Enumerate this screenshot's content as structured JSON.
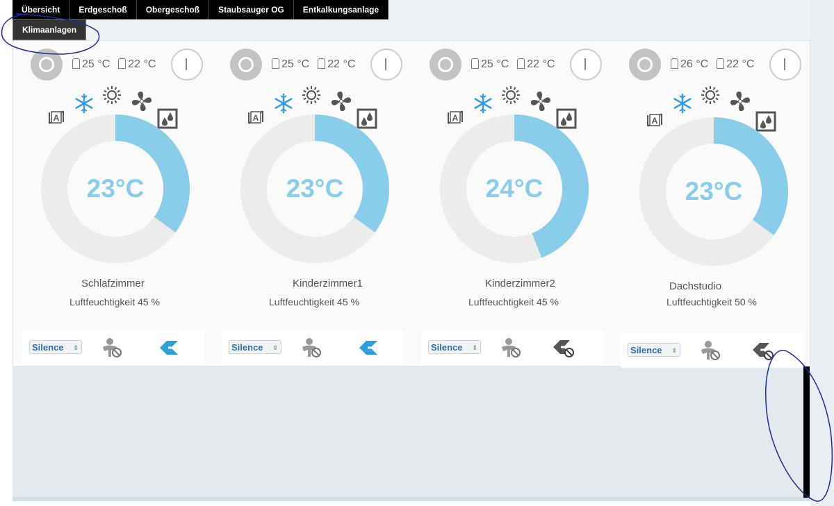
{
  "nav": {
    "tabs": [
      "Übersicht",
      "Erdgeschoß",
      "Obergeschoß",
      "Staubsauger OG",
      "Entkalkungsanlage"
    ],
    "active_tab": "Klimaanlagen"
  },
  "colors": {
    "accent": "#89cdeb",
    "track": "#ececec",
    "icon": "#555555",
    "select_text": "#2d6eab",
    "annotation": "#1c2aa0"
  },
  "units": [
    {
      "room": "Schlafzimmer",
      "setpoint": "23°C",
      "indoor_temp": "25 °C",
      "outdoor_temp": "22 °C",
      "humidity": "Luftfeuchtigkeit 45 %",
      "gauge_fraction": 0.35,
      "fan_mode": "Silence",
      "swing_active": true
    },
    {
      "room": "Kinderzimmer1",
      "setpoint": "23°C",
      "indoor_temp": "25 °C",
      "outdoor_temp": "22 °C",
      "humidity": "Luftfeuchtigkeit 45 %",
      "gauge_fraction": 0.35,
      "fan_mode": "Silence",
      "swing_active": true
    },
    {
      "room": "Kinderzimmer2",
      "setpoint": "24°C",
      "indoor_temp": "25 °C",
      "outdoor_temp": "22 °C",
      "humidity": "Luftfeuchtigkeit 45 %",
      "gauge_fraction": 0.44,
      "fan_mode": "Silence",
      "swing_active": false
    },
    {
      "room": "Dachstudio",
      "setpoint": "23°C",
      "indoor_temp": "26 °C",
      "outdoor_temp": "22 °C",
      "humidity": "Luftfeuchtigkeit 50 %",
      "gauge_fraction": 0.35,
      "fan_mode": "Silence",
      "swing_active": false
    }
  ],
  "icons": [
    "power-off-icon",
    "house-temperature-icon",
    "outdoor-temperature-icon",
    "power-on-icon",
    "auto-mode-icon",
    "cool-snowflake-icon",
    "heat-sun-icon",
    "fan-icon",
    "dry-mode-icon",
    "presence-sensor-off-icon",
    "swing-icon"
  ]
}
